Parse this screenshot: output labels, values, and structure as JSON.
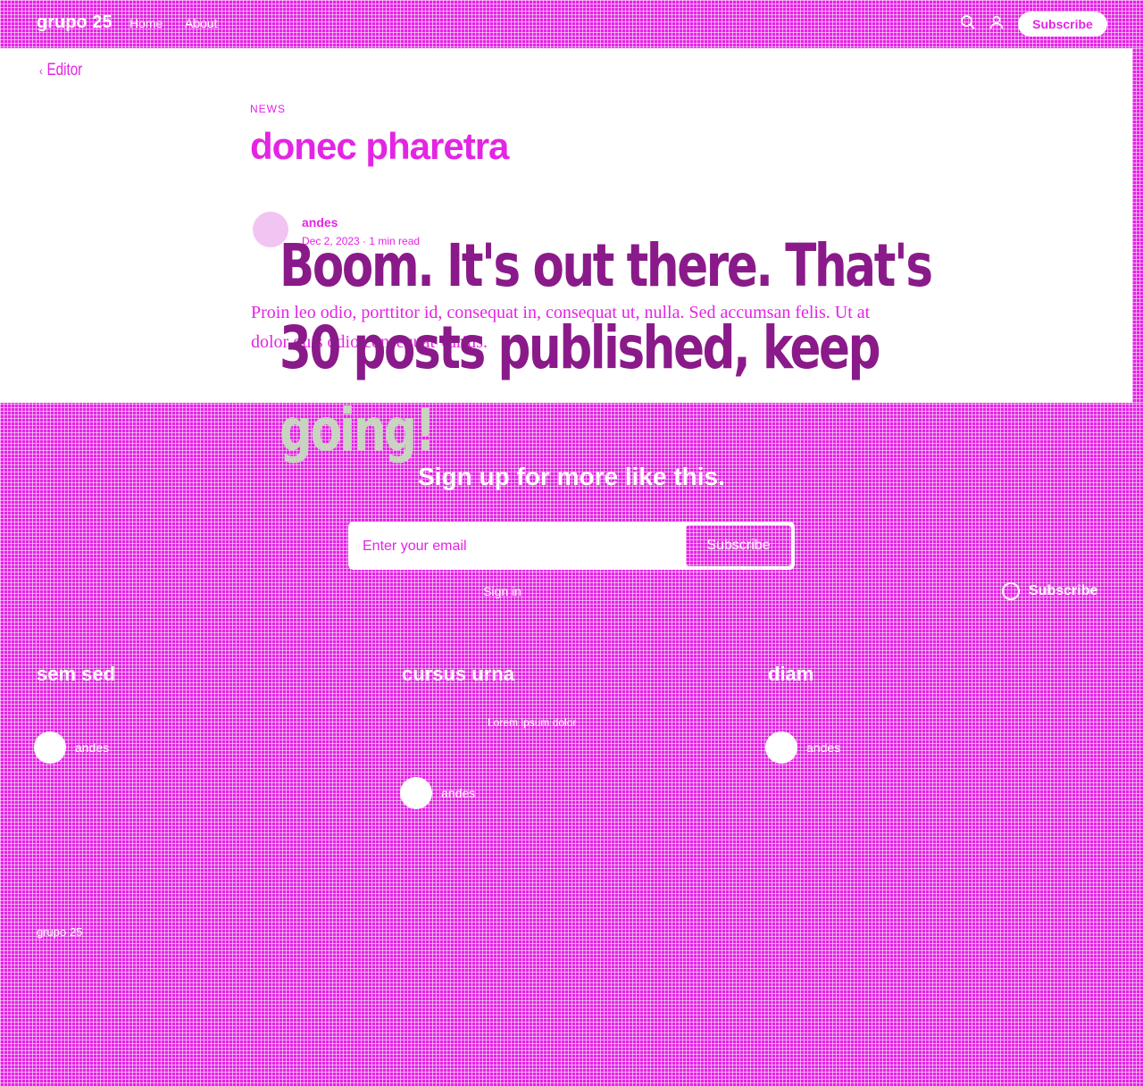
{
  "nav": {
    "brand": "grupo 25",
    "links": [
      "Home",
      "About"
    ],
    "subscribe_label": "Subscribe"
  },
  "article": {
    "back_label": "Editor",
    "category": "NEWS",
    "title": "donec pharetra",
    "author": "andes",
    "meta": "Dec 2, 2023 · 1 min read",
    "excerpt": "Proin leo odio, porttitor id, consequat in, consequat ut, nulla. Sed accumsan felis. Ut at dolor quis odio consequat varius."
  },
  "celebration": {
    "line1": "Boom. It's out there. That's",
    "line2": "30 posts published, keep",
    "line3": "going!"
  },
  "signup": {
    "title": "Sign up for more like this.",
    "email_placeholder": "Enter your email",
    "subscribe_label": "Subscribe",
    "signin_label": "Sign in"
  },
  "floating_subscribe": {
    "label": "Subscribe"
  },
  "related": [
    {
      "title": "sem sed",
      "author": "andes"
    },
    {
      "title": "cursus urna",
      "author": "andes",
      "excerpt": "Lorem ipsum dolor"
    },
    {
      "title": "diam",
      "author": "andes"
    }
  ],
  "footer": {
    "brand": "grupo 25"
  },
  "colors": {
    "accent": "#e424e4",
    "celebration_text": "#8a1a8a",
    "background": "#ffffff"
  }
}
